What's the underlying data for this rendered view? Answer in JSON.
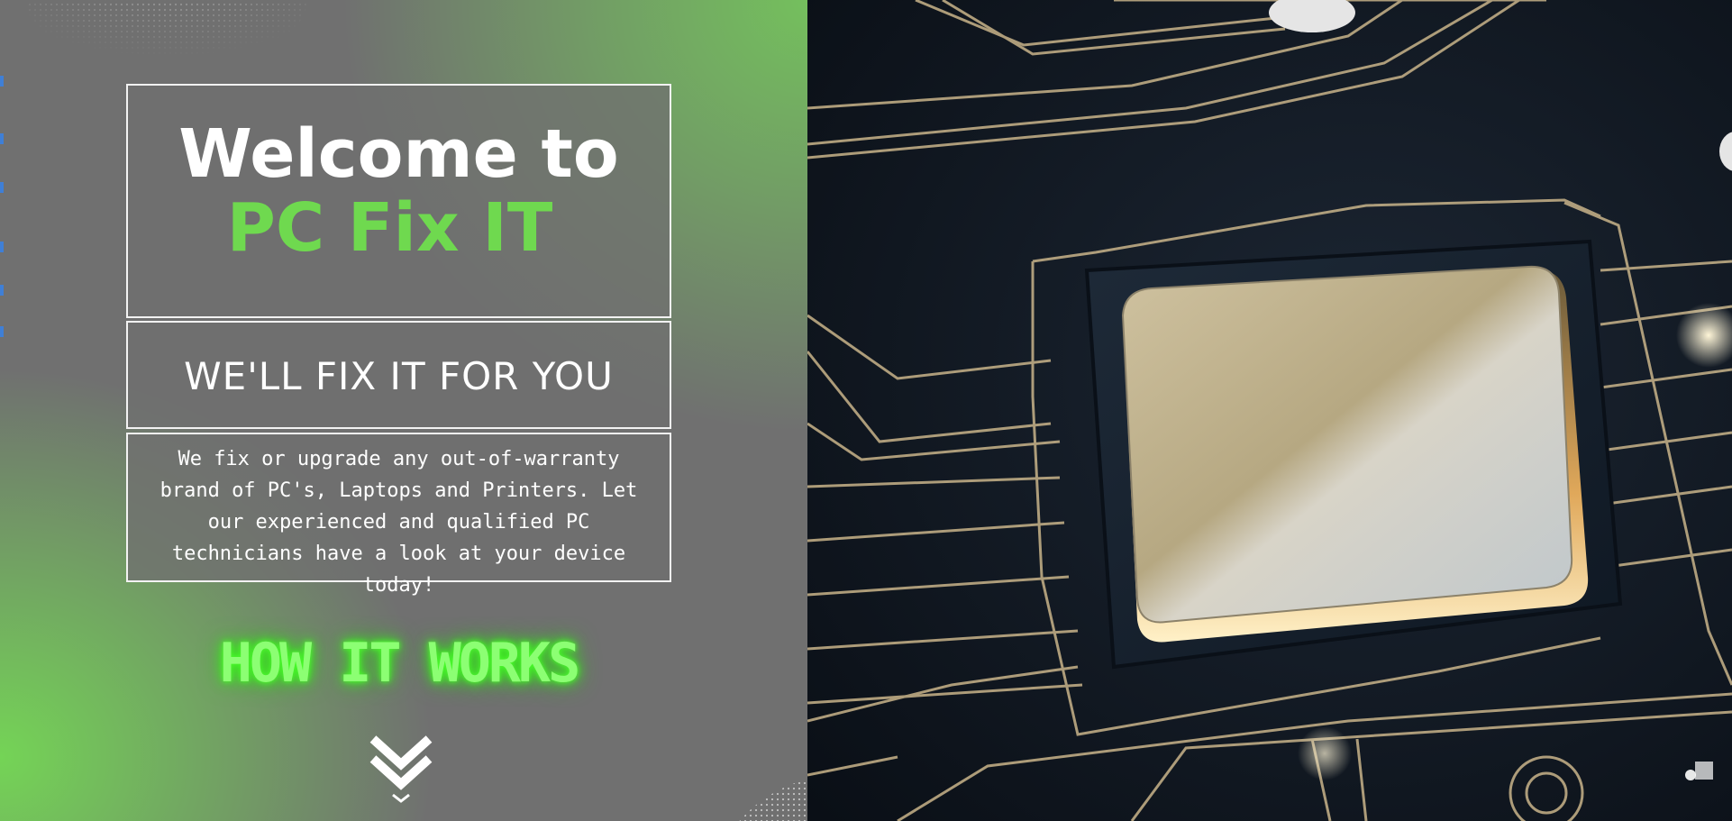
{
  "hero": {
    "title_line1": "Welcome to",
    "title_line2": "PC Fix IT",
    "tagline": "WE'LL FIX IT FOR YOU",
    "description": "We fix or upgrade any out-of-warranty brand of PC's, Laptops and Printers. Let our experienced and qualified PC technicians have a look at your device today!",
    "cta_label": "HOW IT WORKS",
    "scroll_icon": "double-chevron-down-icon"
  },
  "image": {
    "subject": "circuit-board-processor-chip"
  },
  "colors": {
    "panel_gray": "#707070",
    "accent_green": "#6fd94f",
    "glow_green": "#8cff73",
    "text_white": "#ffffff",
    "board_dark": "#0f1620",
    "trace_gold": "#c9b48a"
  }
}
